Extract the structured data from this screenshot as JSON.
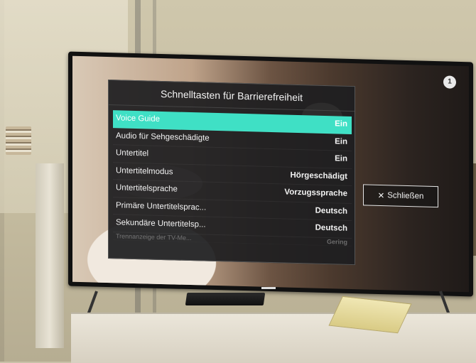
{
  "menu": {
    "title": "Schnelltasten für Barrierefreiheit",
    "items": [
      {
        "label": "Voice Guide",
        "value": "Ein",
        "selected": true
      },
      {
        "label": "Audio für Sehgeschädigte",
        "value": "Ein"
      },
      {
        "label": "Untertitel",
        "value": "Ein"
      },
      {
        "label": "Untertitelmodus",
        "value": "Hörgeschädigt"
      },
      {
        "label": "Untertitelsprache",
        "value": "Vorzugssprache"
      },
      {
        "label": "Primäre Untertitelsprac...",
        "value": "Deutsch"
      },
      {
        "label": "Sekundäre Untertitelsp...",
        "value": "Deutsch"
      },
      {
        "label": "Trennanzeige der TV-Me...",
        "value": "Gering"
      }
    ],
    "close_label": "Schließen",
    "close_icon": "✕"
  },
  "colors": {
    "selection": "#3fe0c5",
    "panel_bg": "#1e1e20"
  }
}
